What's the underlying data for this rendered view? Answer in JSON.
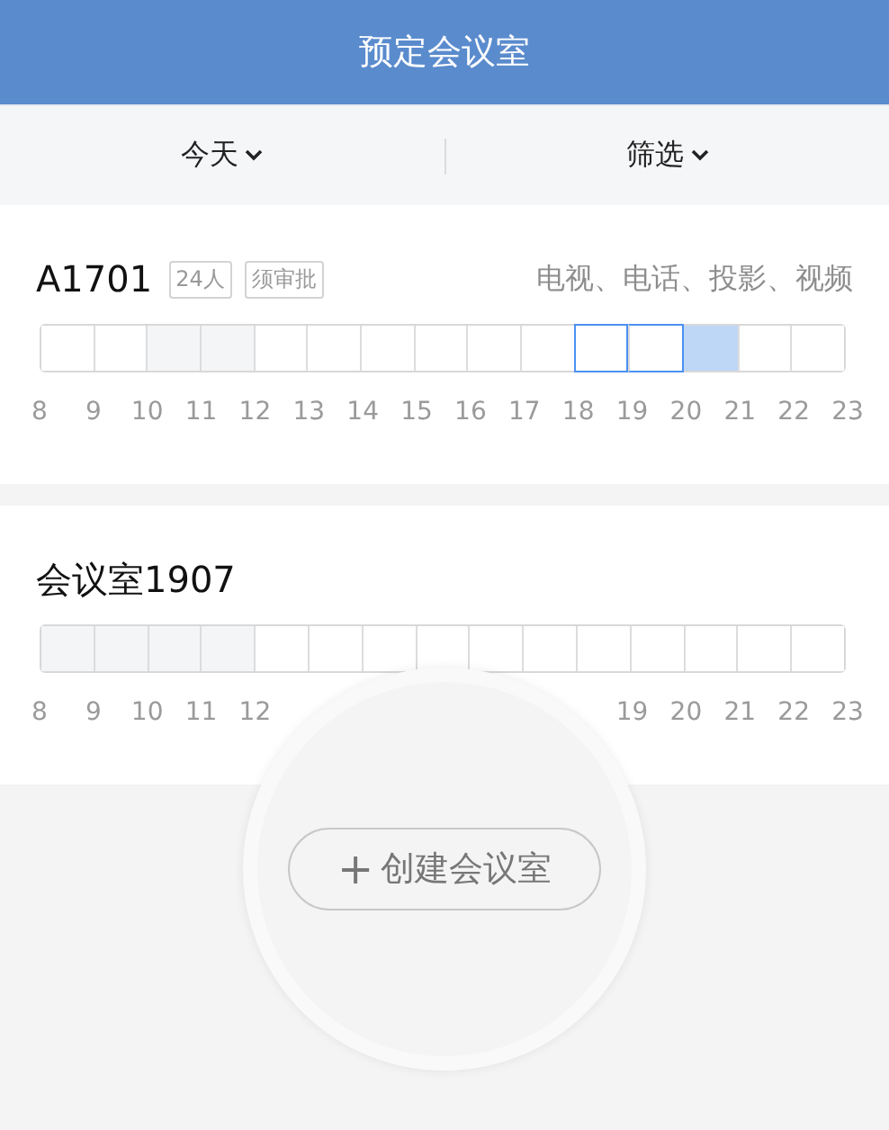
{
  "header": {
    "title": "预定会议室"
  },
  "filters": [
    {
      "label": "今天"
    },
    {
      "label": "筛选"
    }
  ],
  "rooms": [
    {
      "name": "A1701",
      "tags": [
        "24人",
        "须审批"
      ],
      "facilities": "电视、电话、投影、视频",
      "slots": [
        {
          "kind": "free"
        },
        {
          "kind": "free"
        },
        {
          "kind": "unavailable"
        },
        {
          "kind": "unavailable"
        },
        {
          "kind": "free"
        },
        {
          "kind": "free"
        },
        {
          "kind": "free"
        },
        {
          "kind": "free"
        },
        {
          "kind": "free"
        },
        {
          "kind": "free"
        },
        {
          "kind": "selected"
        },
        {
          "kind": "selected"
        },
        {
          "kind": "booked"
        },
        {
          "kind": "free"
        },
        {
          "kind": "free"
        }
      ],
      "hours": [
        {
          "label": "8"
        },
        {
          "label": "9"
        },
        {
          "label": "10"
        },
        {
          "label": "11"
        },
        {
          "label": "12"
        },
        {
          "label": "13"
        },
        {
          "label": "14"
        },
        {
          "label": "15"
        },
        {
          "label": "16"
        },
        {
          "label": "17"
        },
        {
          "label": "18"
        },
        {
          "label": "19"
        },
        {
          "label": "20"
        },
        {
          "label": "21"
        },
        {
          "label": "22"
        },
        {
          "label": "23"
        }
      ]
    },
    {
      "name": "会议室1907",
      "slots": [
        {
          "kind": "unavailable"
        },
        {
          "kind": "unavailable"
        },
        {
          "kind": "unavailable"
        },
        {
          "kind": "unavailable"
        },
        {
          "kind": "free"
        },
        {
          "kind": "free"
        },
        {
          "kind": "free"
        },
        {
          "kind": "free"
        },
        {
          "kind": "free"
        },
        {
          "kind": "free"
        },
        {
          "kind": "free"
        },
        {
          "kind": "free"
        },
        {
          "kind": "free"
        },
        {
          "kind": "free"
        },
        {
          "kind": "free"
        }
      ],
      "hours_start": [
        {
          "label": "8"
        },
        {
          "label": "9"
        },
        {
          "label": "10"
        },
        {
          "label": "11"
        },
        {
          "label": "12"
        }
      ],
      "hours_end": [
        {
          "label": "19"
        },
        {
          "label": "20"
        },
        {
          "label": "21"
        },
        {
          "label": "22"
        },
        {
          "label": "23"
        }
      ]
    }
  ],
  "create_button": {
    "icon": "+",
    "label": "创建会议室"
  }
}
